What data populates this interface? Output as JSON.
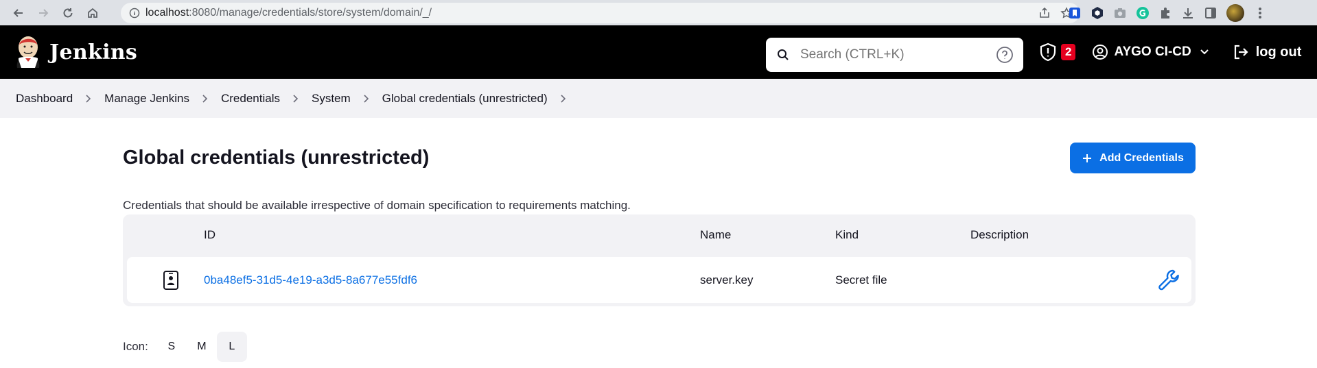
{
  "browser": {
    "url_host": "localhost",
    "url_path": ":8080/manage/credentials/store/system/domain/_/"
  },
  "header": {
    "brand": "Jenkins",
    "search_placeholder": "Search (CTRL+K)",
    "security_count": "2",
    "user_name": "AYGO CI-CD",
    "logout_label": "log out"
  },
  "breadcrumbs": [
    "Dashboard",
    "Manage Jenkins",
    "Credentials",
    "System",
    "Global credentials (unrestricted)"
  ],
  "main": {
    "title": "Global credentials (unrestricted)",
    "add_button": "Add Credentials",
    "description": "Credentials that should be available irrespective of domain specification to requirements matching."
  },
  "table": {
    "columns": [
      "ID",
      "Name",
      "Kind",
      "Description"
    ],
    "rows": [
      {
        "icon": "secret-file-icon",
        "id": "0ba48ef5-31d5-4e19-a3d5-8a677e55fdf6",
        "name": "server.key",
        "kind": "Secret file",
        "description": ""
      }
    ]
  },
  "icon_size": {
    "label": "Icon:",
    "options": [
      "S",
      "M",
      "L"
    ],
    "selected": "L"
  },
  "colors": {
    "accent": "#0b6fe4",
    "header_bg": "#000000",
    "badge": "#e6001f"
  }
}
